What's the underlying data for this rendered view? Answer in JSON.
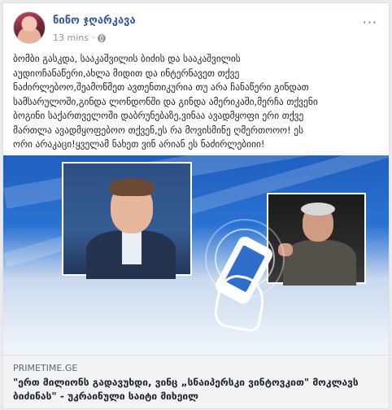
{
  "post": {
    "author": "ნინო ჯღარკავა",
    "time": "13 mins",
    "separator": "·",
    "more": "···",
    "text": "ბომბი გასკდა, სააკაშვილის ბიძის და სააკაშვილის\nაუდიოჩანაწერი,ახლა მიდით და ინტერნავეთ თქვე\nნაძირლებოო,შეამოწმეთ ავთენთიკურია თუ არა ჩანაწერი გინდათ\nსამსარულოში,გინდა ლონდონში და გინდა ამერიკაში,მერჩა თქვენი\nბოგინი საქართველოში დაბრუნებაზე,ვინაა ავადმყოფი ერი თქვე\nმართლა ავადმყოფებოო თქვენ,ეს რა მოვისმინე ღმერთოოო! ეს\nორი არაკაცი!ყველამ ნახეთ ვინ არიან ეს ნაძირლებიიი!"
  },
  "link": {
    "domain": "PRIMETIME.GE",
    "title": "\"ერთ მილიონს გადავუხდი, ვინც „სნაიპერსკი ვინტოვკით\" მოკლავს ბიძინას\" - უკრაინული საიტი მიხეილ"
  },
  "colors": {
    "author": "#385898",
    "background": "#e9ebee",
    "link_bg": "#f2f3f5"
  }
}
